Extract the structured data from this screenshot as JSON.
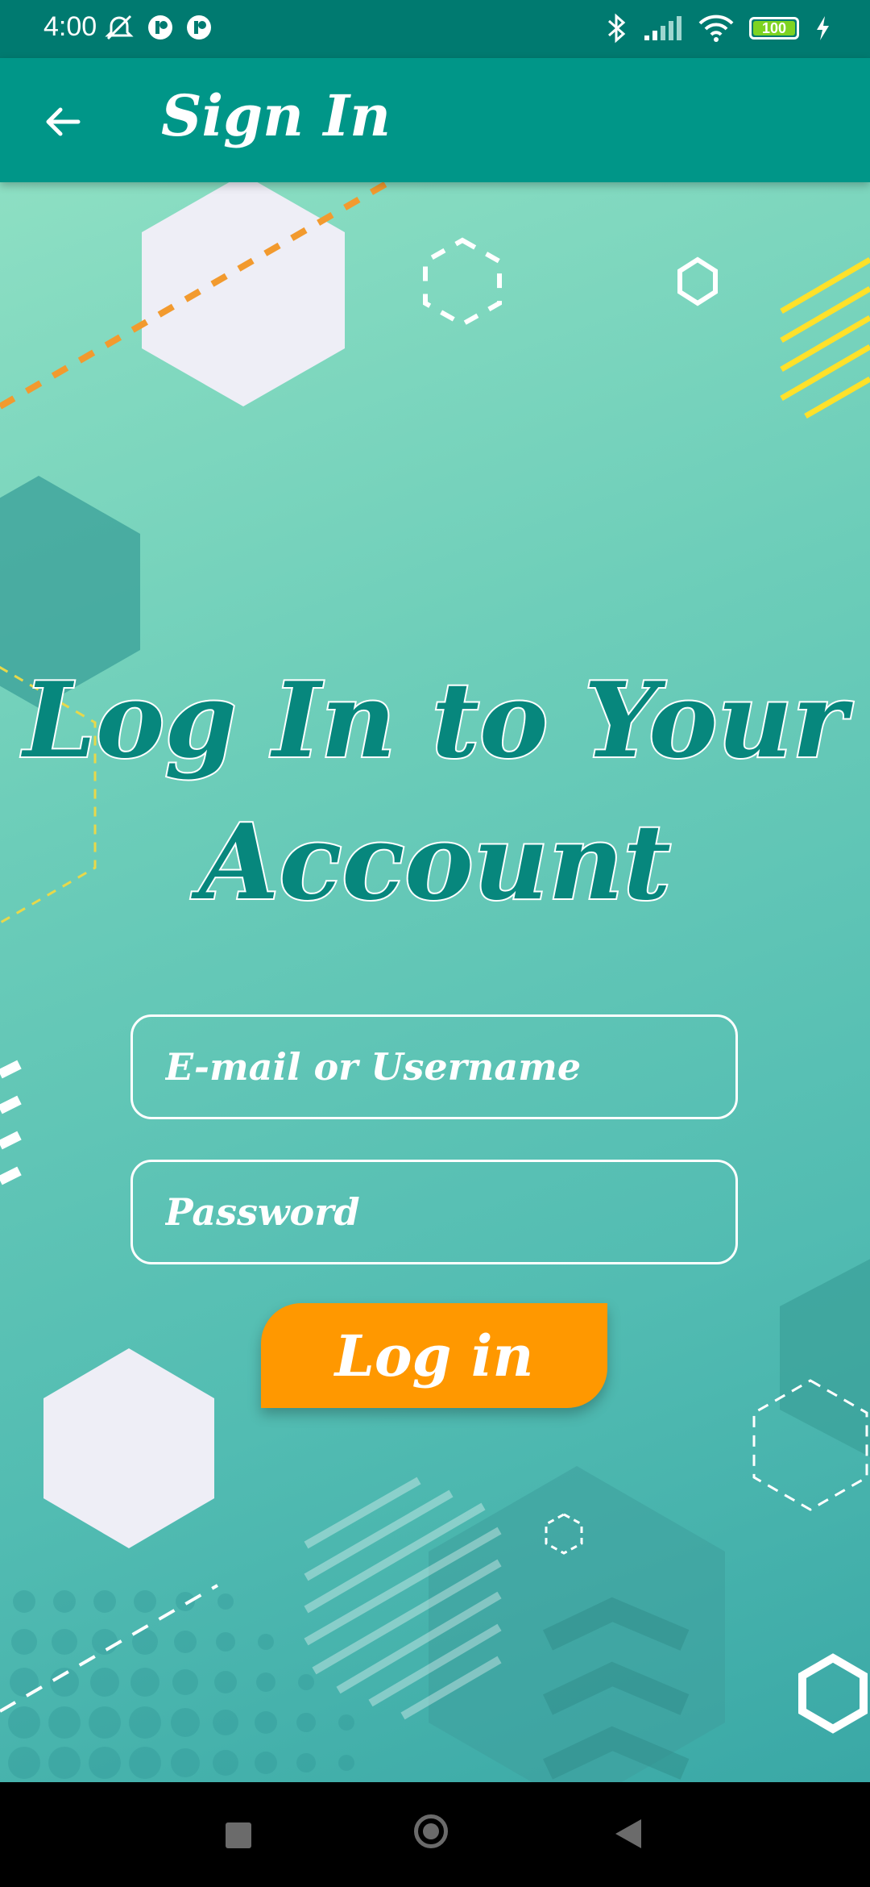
{
  "status_bar": {
    "time": "4:00",
    "battery_level": "100",
    "icons_left": [
      "mute-alarm-icon",
      "notification-icon",
      "notification-icon"
    ],
    "icons_right": [
      "bluetooth-icon",
      "signal-icon",
      "wifi-icon",
      "battery-icon",
      "charging-icon"
    ]
  },
  "app_bar": {
    "title": "Sign In",
    "back_icon": "arrow-left-icon"
  },
  "main": {
    "heading": "Log In to Your Account",
    "email_placeholder": "E-mail or Username",
    "password_placeholder": "Password",
    "login_label": "Log in"
  },
  "colors": {
    "status_bar": "#007a70",
    "app_bar": "#009688",
    "accent": "#ff9800",
    "heading": "#07877d",
    "background_top": "#8ddfc3",
    "background_bottom": "#3aa8a6"
  },
  "nav_bar": {
    "buttons": [
      "recent-apps-icon",
      "home-icon",
      "back-icon"
    ]
  }
}
